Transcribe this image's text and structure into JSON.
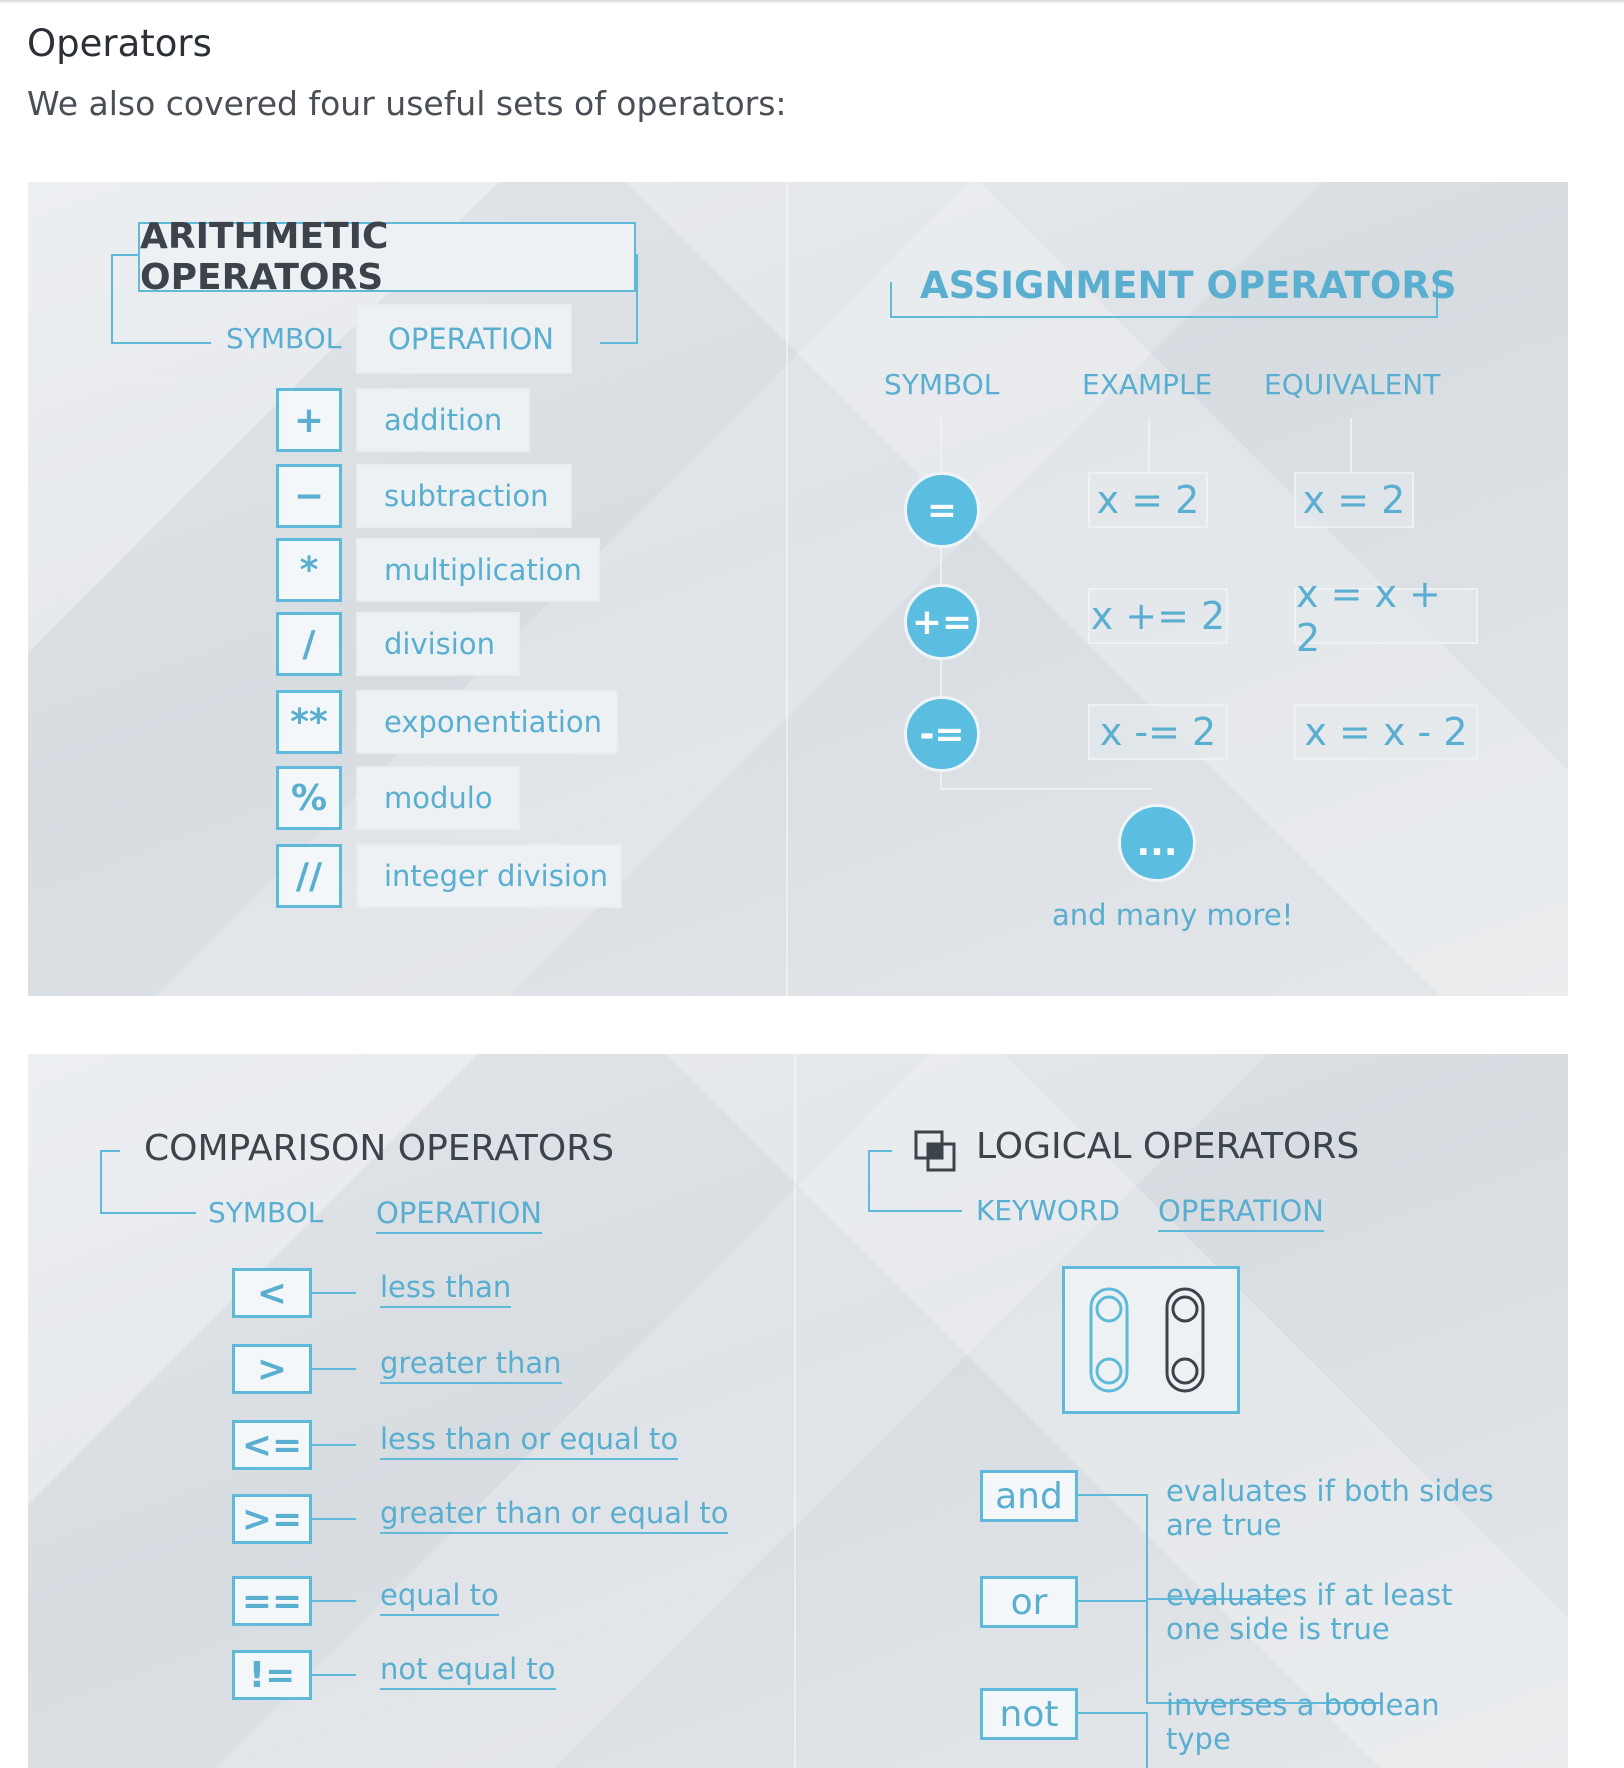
{
  "heading": "Operators",
  "intro": "We also covered four useful sets of operators:",
  "arithmetic": {
    "title": "ARITHMETIC OPERATORS",
    "col_symbol": "SYMBOL",
    "col_operation": "OPERATION",
    "rows": [
      {
        "symbol": "+",
        "operation": "addition"
      },
      {
        "symbol": "−",
        "operation": "subtraction"
      },
      {
        "symbol": "*",
        "operation": "multiplication"
      },
      {
        "symbol": "/",
        "operation": "division"
      },
      {
        "symbol": "**",
        "operation": "exponentiation"
      },
      {
        "symbol": "%",
        "operation": "modulo"
      },
      {
        "symbol": "//",
        "operation": "integer division"
      }
    ]
  },
  "assignment": {
    "title": "ASSIGNMENT OPERATORS",
    "col_symbol": "SYMBOL",
    "col_example": "EXAMPLE",
    "col_equivalent": "EQUIVALENT",
    "rows": [
      {
        "symbol": "=",
        "example": "x = 2",
        "equivalent": "x = 2"
      },
      {
        "symbol": "+=",
        "example": "x += 2",
        "equivalent": "x = x + 2"
      },
      {
        "symbol": "-=",
        "example": "x -= 2",
        "equivalent": "x = x - 2"
      }
    ],
    "more_symbol": "...",
    "more_label": "and many more!"
  },
  "comparison": {
    "title": "COMPARISON OPERATORS",
    "col_symbol": "SYMBOL",
    "col_operation": "OPERATION",
    "rows": [
      {
        "symbol": "<",
        "operation": "less than"
      },
      {
        "symbol": ">",
        "operation": "greater than"
      },
      {
        "symbol": "<=",
        "operation": "less than or equal to"
      },
      {
        "symbol": ">=",
        "operation": "greater than or equal to"
      },
      {
        "symbol": "==",
        "operation": "equal to"
      },
      {
        "symbol": "!=",
        "operation": "not equal to"
      }
    ]
  },
  "logical": {
    "title": "LOGICAL OPERATORS",
    "col_keyword": "KEYWORD",
    "col_operation": "OPERATION",
    "rows": [
      {
        "keyword": "and",
        "desc_line1": "evaluates if both sides",
        "desc_line2": "are true"
      },
      {
        "keyword": "or",
        "desc_line1": "evaluates if at least",
        "desc_line2": "one side is true"
      },
      {
        "keyword": "not",
        "desc_line1": "inverses a boolean",
        "desc_line2": "type"
      }
    ]
  },
  "colors": {
    "accent": "#5bbde0",
    "text_dark": "#3d434b",
    "panel_bg": "#dde1e5"
  },
  "icons": [
    "logic-venn-icon",
    "toggle-switch-icon"
  ]
}
